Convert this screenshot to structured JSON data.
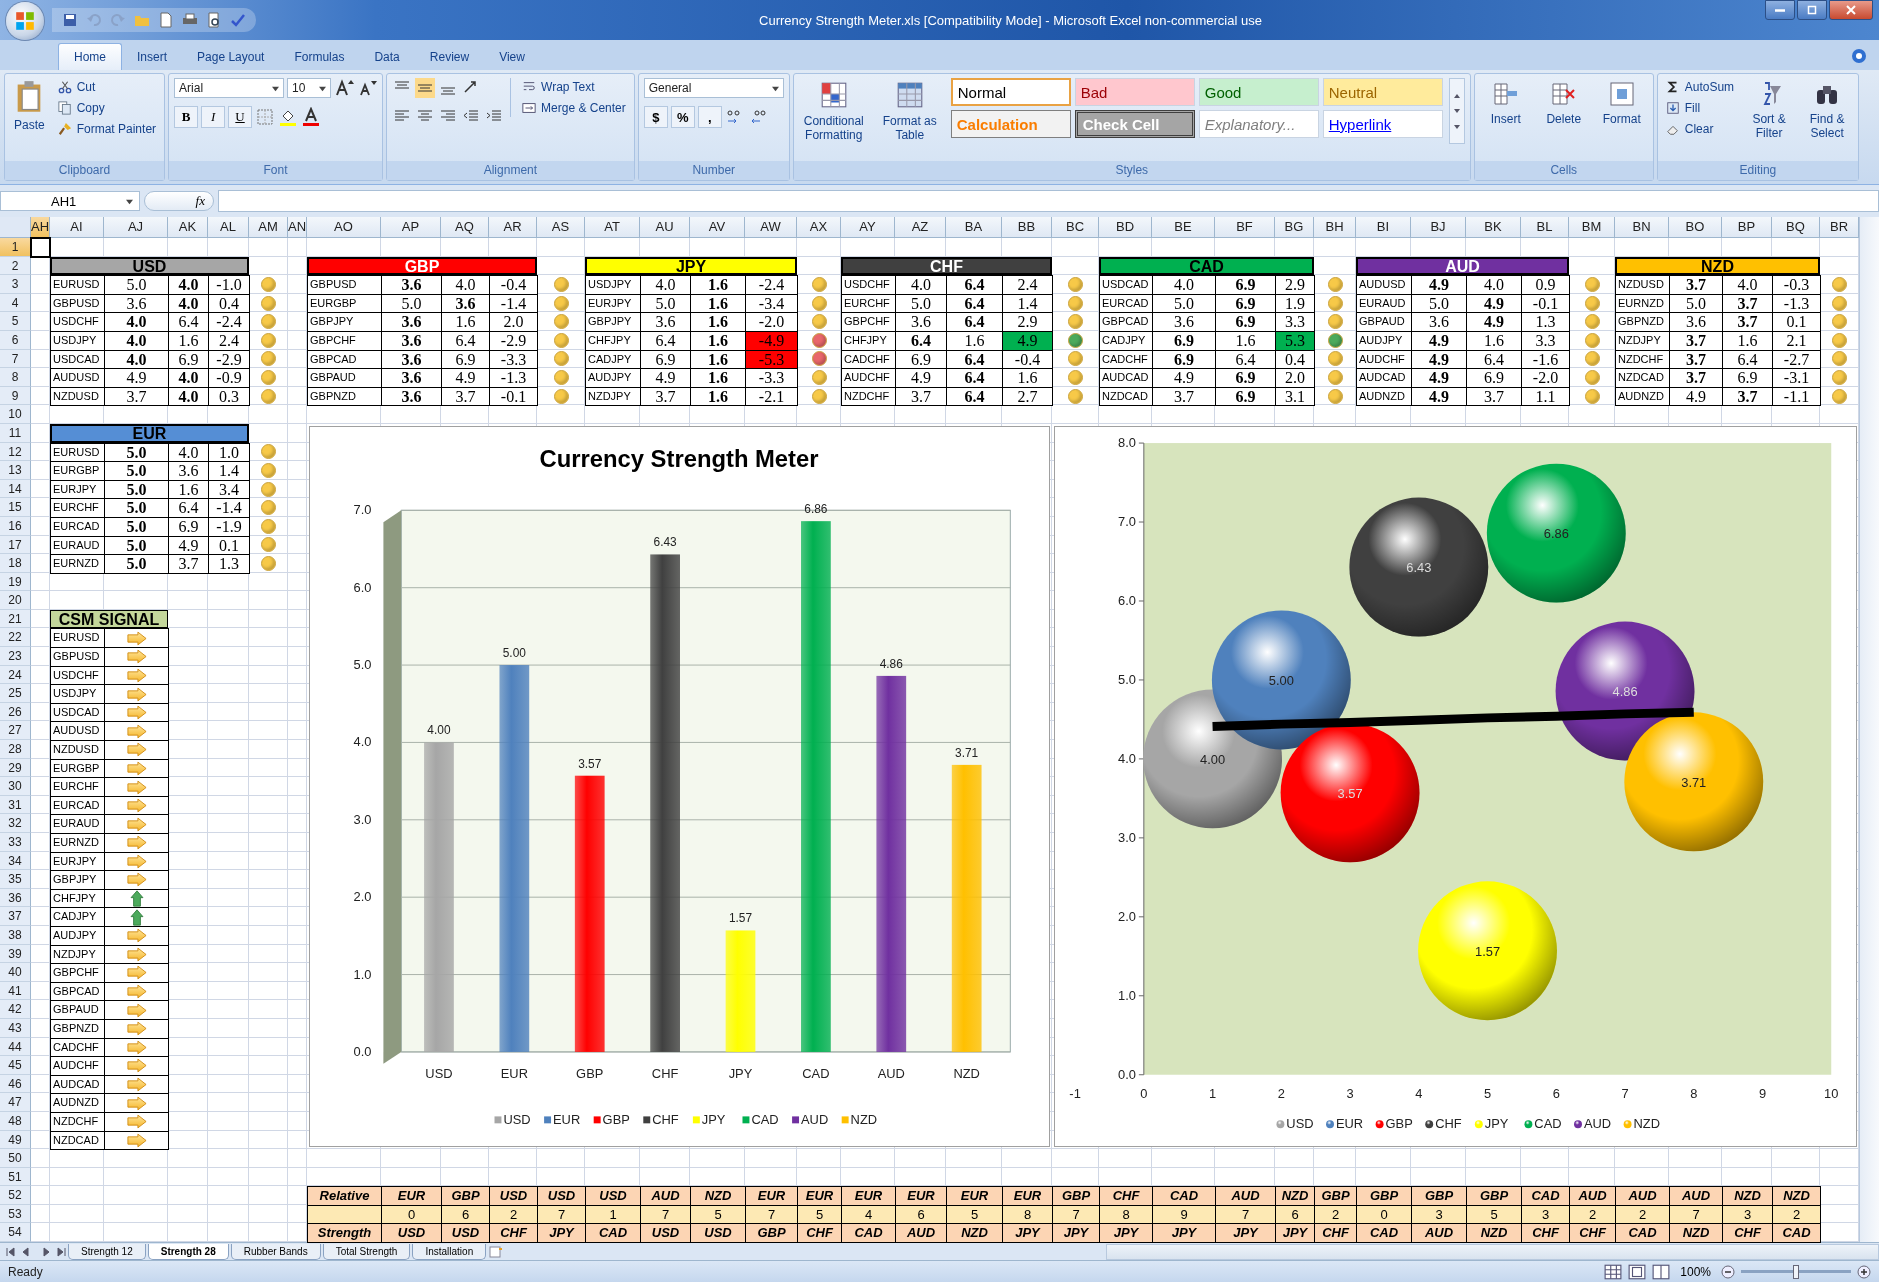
{
  "window": {
    "title": "Currency Strength Meter.xls  [Compatibility Mode] - Microsoft Excel non-commercial use"
  },
  "ribbon_tabs": [
    {
      "label": "Home",
      "selected": true
    },
    {
      "label": "Insert",
      "selected": false
    },
    {
      "label": "Page Layout",
      "selected": false
    },
    {
      "label": "Formulas",
      "selected": false
    },
    {
      "label": "Data",
      "selected": false
    },
    {
      "label": "Review",
      "selected": false
    },
    {
      "label": "View",
      "selected": false
    }
  ],
  "clipboard": {
    "label": "Clipboard",
    "paste": "Paste",
    "items": [
      "Cut",
      "Copy",
      "Format Painter"
    ]
  },
  "font": {
    "label": "Font",
    "family": "Arial",
    "size": "10",
    "styles": [
      "B",
      "I",
      "U"
    ]
  },
  "alignment": {
    "label": "Alignment",
    "items": [
      "Wrap Text",
      "Merge & Center"
    ]
  },
  "number": {
    "label": "Number",
    "format": "General",
    "symbols": [
      "$",
      "%",
      ","
    ]
  },
  "styles": {
    "label": "Styles",
    "buttons": [
      "Conditional Formatting",
      "Format as Table"
    ],
    "cell_styles": [
      {
        "label": "Normal",
        "kind": "normal"
      },
      {
        "label": "Bad",
        "kind": "bad"
      },
      {
        "label": "Good",
        "kind": "good"
      },
      {
        "label": "Neutral",
        "kind": "neutral"
      },
      {
        "label": "Calculation",
        "kind": "calculation"
      },
      {
        "label": "Check Cell",
        "kind": "check"
      },
      {
        "label": "Explanatory...",
        "kind": "explanatory"
      },
      {
        "label": "Hyperlink",
        "kind": "hyperlink"
      }
    ]
  },
  "cells": {
    "label": "Cells",
    "items": [
      "Insert",
      "Delete",
      "Format"
    ]
  },
  "editing": {
    "label": "Editing",
    "items": [
      "AutoSum",
      "Fill",
      "Clear"
    ],
    "big": [
      "Sort & Filter",
      "Find & Select"
    ]
  },
  "name_box": "AH1",
  "formula_label": "fx",
  "columns": [
    {
      "label": "AH",
      "selected": true
    },
    {
      "label": "AI",
      "selected": false
    },
    {
      "label": "AJ",
      "selected": false
    },
    {
      "label": "AK",
      "selected": false
    },
    {
      "label": "AL",
      "selected": false
    },
    {
      "label": "AM",
      "selected": false
    },
    {
      "label": "AN",
      "selected": false
    },
    {
      "label": "AO",
      "selected": false
    },
    {
      "label": "AP",
      "selected": false
    },
    {
      "label": "AQ",
      "selected": false
    },
    {
      "label": "AR",
      "selected": false
    },
    {
      "label": "AS",
      "selected": false
    },
    {
      "label": "AT",
      "selected": false
    },
    {
      "label": "AU",
      "selected": false
    },
    {
      "label": "AV",
      "selected": false
    },
    {
      "label": "AW",
      "selected": false
    },
    {
      "label": "AX",
      "selected": false
    },
    {
      "label": "AY",
      "selected": false
    },
    {
      "label": "AZ",
      "selected": false
    },
    {
      "label": "BA",
      "selected": false
    },
    {
      "label": "BB",
      "selected": false
    },
    {
      "label": "BC",
      "selected": false
    },
    {
      "label": "BD",
      "selected": false
    },
    {
      "label": "BE",
      "selected": false
    },
    {
      "label": "BF",
      "selected": false
    },
    {
      "label": "BG",
      "selected": false
    },
    {
      "label": "BH",
      "selected": false
    },
    {
      "label": "BI",
      "selected": false
    },
    {
      "label": "BJ",
      "selected": false
    },
    {
      "label": "BK",
      "selected": false
    },
    {
      "label": "BL",
      "selected": false
    },
    {
      "label": "BM",
      "selected": false
    },
    {
      "label": "BN",
      "selected": false
    },
    {
      "label": "BO",
      "selected": false
    },
    {
      "label": "BP",
      "selected": false
    },
    {
      "label": "BQ",
      "selected": false
    },
    {
      "label": "BR",
      "selected": false
    }
  ],
  "rows": [
    {
      "label": "1",
      "selected": true
    },
    {
      "label": "2",
      "selected": false
    },
    {
      "label": "3",
      "selected": false
    },
    {
      "label": "4",
      "selected": false
    },
    {
      "label": "5",
      "selected": false
    },
    {
      "label": "6",
      "selected": false
    },
    {
      "label": "7",
      "selected": false
    },
    {
      "label": "8",
      "selected": false
    },
    {
      "label": "9",
      "selected": false
    },
    {
      "label": "10",
      "selected": false
    },
    {
      "label": "11",
      "selected": false
    },
    {
      "label": "12",
      "selected": false
    },
    {
      "label": "13",
      "selected": false
    },
    {
      "label": "14",
      "selected": false
    },
    {
      "label": "15",
      "selected": false
    },
    {
      "label": "16",
      "selected": false
    },
    {
      "label": "17",
      "selected": false
    },
    {
      "label": "18",
      "selected": false
    },
    {
      "label": "19",
      "selected": false
    },
    {
      "label": "20",
      "selected": false
    },
    {
      "label": "21",
      "selected": false
    },
    {
      "label": "22",
      "selected": false
    },
    {
      "label": "23",
      "selected": false
    },
    {
      "label": "24",
      "selected": false
    },
    {
      "label": "25",
      "selected": false
    },
    {
      "label": "26",
      "selected": false
    },
    {
      "label": "27",
      "selected": false
    },
    {
      "label": "28",
      "selected": false
    },
    {
      "label": "29",
      "selected": false
    },
    {
      "label": "30",
      "selected": false
    },
    {
      "label": "31",
      "selected": false
    },
    {
      "label": "32",
      "selected": false
    },
    {
      "label": "33",
      "selected": false
    },
    {
      "label": "34",
      "selected": false
    },
    {
      "label": "35",
      "selected": false
    },
    {
      "label": "36",
      "selected": false
    },
    {
      "label": "37",
      "selected": false
    },
    {
      "label": "38",
      "selected": false
    },
    {
      "label": "39",
      "selected": false
    },
    {
      "label": "40",
      "selected": false
    },
    {
      "label": "41",
      "selected": false
    },
    {
      "label": "42",
      "selected": false
    },
    {
      "label": "43",
      "selected": false
    },
    {
      "label": "44",
      "selected": false
    },
    {
      "label": "45",
      "selected": false
    },
    {
      "label": "46",
      "selected": false
    },
    {
      "label": "47",
      "selected": false
    },
    {
      "label": "48",
      "selected": false
    },
    {
      "label": "49",
      "selected": false
    },
    {
      "label": "50",
      "selected": false
    },
    {
      "label": "51",
      "selected": false
    },
    {
      "label": "52",
      "selected": false
    },
    {
      "label": "53",
      "selected": false
    },
    {
      "label": "54",
      "selected": false
    }
  ],
  "tables": [
    {
      "currency": "USD",
      "color": "#a6a6a6",
      "rows": [
        {
          "pair": "EURUSD",
          "values": [
            "5.0",
            "4.0",
            "-1.0"
          ],
          "bold": [
            false,
            true
          ],
          "color": "#f7c948"
        },
        {
          "pair": "GBPUSD",
          "values": [
            "3.6",
            "4.0",
            "0.4"
          ],
          "bold": [
            false,
            true
          ],
          "color": "#f7c948"
        },
        {
          "pair": "USDCHF",
          "values": [
            "4.0",
            "6.4",
            "-2.4"
          ],
          "bold": [
            true,
            false
          ],
          "color": "#f7c948"
        },
        {
          "pair": "USDJPY",
          "values": [
            "4.0",
            "1.6",
            "2.4"
          ],
          "bold": [
            true,
            false
          ],
          "color": "#f7c948"
        },
        {
          "pair": "USDCAD",
          "values": [
            "4.0",
            "6.9",
            "-2.9"
          ],
          "bold": [
            true,
            false
          ],
          "color": "#f7c948"
        },
        {
          "pair": "AUDUSD",
          "values": [
            "4.9",
            "4.0",
            "-0.9"
          ],
          "bold": [
            false,
            true
          ],
          "color": "#f7c948"
        },
        {
          "pair": "NZDUSD",
          "values": [
            "3.7",
            "4.0",
            "0.3"
          ],
          "bold": [
            false,
            true
          ],
          "color": "#f7c948"
        }
      ]
    },
    {
      "currency": "GBP",
      "color": "#ff0000",
      "rows": [
        {
          "pair": "GBPUSD",
          "values": [
            "3.6",
            "4.0",
            "-0.4"
          ],
          "bold": [
            true,
            false
          ],
          "color": "#f7c948"
        },
        {
          "pair": "EURGBP",
          "values": [
            "5.0",
            "3.6",
            "-1.4"
          ],
          "bold": [
            false,
            true
          ],
          "color": "#f7c948"
        },
        {
          "pair": "GBPJPY",
          "values": [
            "3.6",
            "1.6",
            "2.0"
          ],
          "bold": [
            true,
            false
          ],
          "color": "#f7c948"
        },
        {
          "pair": "GBPCHF",
          "values": [
            "3.6",
            "6.4",
            "-2.9"
          ],
          "bold": [
            true,
            false
          ],
          "color": "#f7c948"
        },
        {
          "pair": "GBPCAD",
          "values": [
            "3.6",
            "6.9",
            "-3.3"
          ],
          "bold": [
            true,
            false
          ],
          "color": "#f7c948"
        },
        {
          "pair": "GBPAUD",
          "values": [
            "3.6",
            "4.9",
            "-1.3"
          ],
          "bold": [
            true,
            false
          ],
          "color": "#f7c948"
        },
        {
          "pair": "GBPNZD",
          "values": [
            "3.6",
            "3.7",
            "-0.1"
          ],
          "bold": [
            true,
            false
          ],
          "color": "#f7c948"
        }
      ]
    },
    {
      "currency": "JPY",
      "color": "#ffff00",
      "rows": [
        {
          "pair": "USDJPY",
          "values": [
            "4.0",
            "1.6",
            "-2.4"
          ],
          "bold": [
            false,
            true
          ],
          "color": "#f7c948"
        },
        {
          "pair": "EURJPY",
          "values": [
            "5.0",
            "1.6",
            "-3.4"
          ],
          "bold": [
            false,
            true
          ],
          "color": "#f7c948"
        },
        {
          "pair": "GBPJPY",
          "values": [
            "3.6",
            "1.6",
            "-2.0"
          ],
          "bold": [
            false,
            true
          ],
          "color": "#f7c948"
        },
        {
          "pair": "CHFJPY",
          "values": [
            "6.4",
            "1.6",
            "-4.9"
          ],
          "bold": [
            false,
            true
          ],
          "kind": "low",
          "color": "#e8676b"
        },
        {
          "pair": "CADJPY",
          "values": [
            "6.9",
            "1.6",
            "-5.3"
          ],
          "bold": [
            false,
            true
          ],
          "kind": "low",
          "color": "#e8676b"
        },
        {
          "pair": "AUDJPY",
          "values": [
            "4.9",
            "1.6",
            "-3.3"
          ],
          "bold": [
            false,
            true
          ],
          "color": "#f7c948"
        },
        {
          "pair": "NZDJPY",
          "values": [
            "3.7",
            "1.6",
            "-2.1"
          ],
          "bold": [
            false,
            true
          ],
          "color": "#f7c948"
        }
      ]
    },
    {
      "currency": "CHF",
      "color": "#404040",
      "rows": [
        {
          "pair": "USDCHF",
          "values": [
            "4.0",
            "6.4",
            "2.4"
          ],
          "bold": [
            false,
            true
          ],
          "color": "#f7c948"
        },
        {
          "pair": "EURCHF",
          "values": [
            "5.0",
            "6.4",
            "1.4"
          ],
          "bold": [
            false,
            true
          ],
          "color": "#f7c948"
        },
        {
          "pair": "GBPCHF",
          "values": [
            "3.6",
            "6.4",
            "2.9"
          ],
          "bold": [
            false,
            true
          ],
          "color": "#f7c948"
        },
        {
          "pair": "CHFJPY",
          "values": [
            "6.4",
            "1.6",
            "4.9"
          ],
          "bold": [
            true,
            false
          ],
          "kind": "high",
          "color": "#4caa5c"
        },
        {
          "pair": "CADCHF",
          "values": [
            "6.9",
            "6.4",
            "-0.4"
          ],
          "bold": [
            false,
            true
          ],
          "color": "#f7c948"
        },
        {
          "pair": "AUDCHF",
          "values": [
            "4.9",
            "6.4",
            "1.6"
          ],
          "bold": [
            false,
            true
          ],
          "color": "#f7c948"
        },
        {
          "pair": "NZDCHF",
          "values": [
            "3.7",
            "6.4",
            "2.7"
          ],
          "bold": [
            false,
            true
          ],
          "color": "#f7c948"
        }
      ]
    },
    {
      "currency": "CAD",
      "color": "#00b050",
      "rows": [
        {
          "pair": "USDCAD",
          "values": [
            "4.0",
            "6.9",
            "2.9"
          ],
          "bold": [
            false,
            true
          ],
          "color": "#f7c948"
        },
        {
          "pair": "EURCAD",
          "values": [
            "5.0",
            "6.9",
            "1.9"
          ],
          "bold": [
            false,
            true
          ],
          "color": "#f7c948"
        },
        {
          "pair": "GBPCAD",
          "values": [
            "3.6",
            "6.9",
            "3.3"
          ],
          "bold": [
            false,
            true
          ],
          "color": "#f7c948"
        },
        {
          "pair": "CADJPY",
          "values": [
            "6.9",
            "1.6",
            "5.3"
          ],
          "bold": [
            true,
            false
          ],
          "kind": "high",
          "color": "#4caa5c"
        },
        {
          "pair": "CADCHF",
          "values": [
            "6.9",
            "6.4",
            "0.4"
          ],
          "bold": [
            true,
            false
          ],
          "color": "#f7c948"
        },
        {
          "pair": "AUDCAD",
          "values": [
            "4.9",
            "6.9",
            "2.0"
          ],
          "bold": [
            false,
            true
          ],
          "color": "#f7c948"
        },
        {
          "pair": "NZDCAD",
          "values": [
            "3.7",
            "6.9",
            "3.1"
          ],
          "bold": [
            false,
            true
          ],
          "color": "#f7c948"
        }
      ]
    },
    {
      "currency": "AUD",
      "color": "#7030a0",
      "rows": [
        {
          "pair": "AUDUSD",
          "values": [
            "4.9",
            "4.0",
            "0.9"
          ],
          "bold": [
            true,
            false
          ],
          "color": "#f7c948"
        },
        {
          "pair": "EURAUD",
          "values": [
            "5.0",
            "4.9",
            "-0.1"
          ],
          "bold": [
            false,
            true
          ],
          "color": "#f7c948"
        },
        {
          "pair": "GBPAUD",
          "values": [
            "3.6",
            "4.9",
            "1.3"
          ],
          "bold": [
            false,
            true
          ],
          "color": "#f7c948"
        },
        {
          "pair": "AUDJPY",
          "values": [
            "4.9",
            "1.6",
            "3.3"
          ],
          "bold": [
            true,
            false
          ],
          "color": "#f7c948"
        },
        {
          "pair": "AUDCHF",
          "values": [
            "4.9",
            "6.4",
            "-1.6"
          ],
          "bold": [
            true,
            false
          ],
          "color": "#f7c948"
        },
        {
          "pair": "AUDCAD",
          "values": [
            "4.9",
            "6.9",
            "-2.0"
          ],
          "bold": [
            true,
            false
          ],
          "color": "#f7c948"
        },
        {
          "pair": "AUDNZD",
          "values": [
            "4.9",
            "3.7",
            "1.1"
          ],
          "bold": [
            true,
            false
          ],
          "color": "#f7c948"
        }
      ]
    },
    {
      "currency": "NZD",
      "color": "#ffc000",
      "rows": [
        {
          "pair": "NZDUSD",
          "values": [
            "3.7",
            "4.0",
            "-0.3"
          ],
          "bold": [
            true,
            false
          ],
          "color": "#f7c948"
        },
        {
          "pair": "EURNZD",
          "values": [
            "5.0",
            "3.7",
            "-1.3"
          ],
          "bold": [
            false,
            true
          ],
          "color": "#f7c948"
        },
        {
          "pair": "GBPNZD",
          "values": [
            "3.6",
            "3.7",
            "0.1"
          ],
          "bold": [
            false,
            true
          ],
          "color": "#f7c948"
        },
        {
          "pair": "NZDJPY",
          "values": [
            "3.7",
            "1.6",
            "2.1"
          ],
          "bold": [
            true,
            false
          ],
          "color": "#f7c948"
        },
        {
          "pair": "NZDCHF",
          "values": [
            "3.7",
            "6.4",
            "-2.7"
          ],
          "bold": [
            true,
            false
          ],
          "color": "#f7c948"
        },
        {
          "pair": "NZDCAD",
          "values": [
            "3.7",
            "6.9",
            "-3.1"
          ],
          "bold": [
            true,
            false
          ],
          "color": "#f7c948"
        },
        {
          "pair": "AUDNZD",
          "values": [
            "4.9",
            "3.7",
            "-1.1"
          ],
          "bold": [
            false,
            true
          ],
          "color": "#f7c948"
        }
      ]
    },
    {
      "currency": "EUR",
      "color": "#558ed5",
      "rows": [
        {
          "pair": "EURUSD",
          "values": [
            "5.0",
            "4.0",
            "1.0"
          ],
          "bold": [
            true,
            false
          ],
          "color": "#f7c948"
        },
        {
          "pair": "EURGBP",
          "values": [
            "5.0",
            "3.6",
            "1.4"
          ],
          "bold": [
            true,
            false
          ],
          "color": "#f7c948"
        },
        {
          "pair": "EURJPY",
          "values": [
            "5.0",
            "1.6",
            "3.4"
          ],
          "bold": [
            true,
            false
          ],
          "color": "#f7c948"
        },
        {
          "pair": "EURCHF",
          "values": [
            "5.0",
            "6.4",
            "-1.4"
          ],
          "bold": [
            true,
            false
          ],
          "color": "#f7c948"
        },
        {
          "pair": "EURCAD",
          "values": [
            "5.0",
            "6.9",
            "-1.9"
          ],
          "bold": [
            true,
            false
          ],
          "color": "#f7c948"
        },
        {
          "pair": "EURAUD",
          "values": [
            "5.0",
            "4.9",
            "0.1"
          ],
          "bold": [
            true,
            false
          ],
          "color": "#f7c948"
        },
        {
          "pair": "EURNZD",
          "values": [
            "5.0",
            "3.7",
            "1.3"
          ],
          "bold": [
            true,
            false
          ],
          "color": "#f7c948"
        }
      ]
    }
  ],
  "signal": {
    "title": "CSM SIGNAL",
    "rows": [
      {
        "pair": "EURUSD",
        "kind": "right"
      },
      {
        "pair": "GBPUSD",
        "kind": "right"
      },
      {
        "pair": "USDCHF",
        "kind": "right"
      },
      {
        "pair": "USDJPY",
        "kind": "right"
      },
      {
        "pair": "USDCAD",
        "kind": "right"
      },
      {
        "pair": "AUDUSD",
        "kind": "right"
      },
      {
        "pair": "NZDUSD",
        "kind": "right"
      },
      {
        "pair": "EURGBP",
        "kind": "right"
      },
      {
        "pair": "EURCHF",
        "kind": "right"
      },
      {
        "pair": "EURCAD",
        "kind": "right"
      },
      {
        "pair": "EURAUD",
        "kind": "right"
      },
      {
        "pair": "EURNZD",
        "kind": "right"
      },
      {
        "pair": "EURJPY",
        "kind": "right"
      },
      {
        "pair": "GBPJPY",
        "kind": "right"
      },
      {
        "pair": "CHFJPY",
        "kind": "up"
      },
      {
        "pair": "CADJPY",
        "kind": "up"
      },
      {
        "pair": "AUDJPY",
        "kind": "right"
      },
      {
        "pair": "NZDJPY",
        "kind": "right"
      },
      {
        "pair": "GBPCHF",
        "kind": "right"
      },
      {
        "pair": "GBPCAD",
        "kind": "right"
      },
      {
        "pair": "GBPAUD",
        "kind": "right"
      },
      {
        "pair": "GBPNZD",
        "kind": "right"
      },
      {
        "pair": "CADCHF",
        "kind": "right"
      },
      {
        "pair": "AUDCHF",
        "kind": "right"
      },
      {
        "pair": "AUDCAD",
        "kind": "right"
      },
      {
        "pair": "AUDNZD",
        "kind": "right"
      },
      {
        "pair": "NZDCHF",
        "kind": "right"
      },
      {
        "pair": "NZDCAD",
        "kind": "right"
      }
    ]
  },
  "bar_chart": {
    "chart_data": {
      "type": "bar",
      "title": "Currency Strength Meter",
      "categories": [
        "USD",
        "EUR",
        "GBP",
        "CHF",
        "JPY",
        "CAD",
        "AUD",
        "NZD"
      ],
      "ylim": [
        0,
        7
      ],
      "yticks": [
        {
          "value": 0,
          "label": "0.0"
        },
        {
          "value": 1,
          "label": "1.0"
        },
        {
          "value": 2,
          "label": "2.0"
        },
        {
          "value": 3,
          "label": "3.0"
        },
        {
          "value": 4,
          "label": "4.0"
        },
        {
          "value": 5,
          "label": "5.0"
        },
        {
          "value": 6,
          "label": "6.0"
        },
        {
          "value": 7,
          "label": "7.0"
        }
      ],
      "grid": true,
      "legend": true,
      "series": [
        {
          "name": "USD",
          "color": "#a6a6a6",
          "values": [
            4.0,
            null,
            null,
            null,
            null,
            null,
            null,
            null
          ],
          "value_labels": [
            "4.00",
            null,
            null,
            null,
            null,
            null,
            null,
            null
          ]
        },
        {
          "name": "EUR",
          "color": "#4f81bd",
          "values": [
            null,
            5.0,
            null,
            null,
            null,
            null,
            null,
            null
          ],
          "value_labels": [
            null,
            "5.00",
            null,
            null,
            null,
            null,
            null,
            null
          ]
        },
        {
          "name": "GBP",
          "color": "#ff0000",
          "values": [
            null,
            null,
            3.57,
            null,
            null,
            null,
            null,
            null
          ],
          "value_labels": [
            null,
            null,
            "3.57",
            null,
            null,
            null,
            null,
            null
          ]
        },
        {
          "name": "CHF",
          "color": "#404040",
          "values": [
            null,
            null,
            null,
            6.43,
            null,
            null,
            null,
            null
          ],
          "value_labels": [
            null,
            null,
            null,
            "6.43",
            null,
            null,
            null,
            null
          ]
        },
        {
          "name": "JPY",
          "color": "#ffff00",
          "values": [
            null,
            null,
            null,
            null,
            1.57,
            null,
            null,
            null
          ],
          "value_labels": [
            null,
            null,
            null,
            null,
            "1.57",
            null,
            null,
            null
          ]
        },
        {
          "name": "CAD",
          "color": "#00b050",
          "values": [
            null,
            null,
            null,
            null,
            null,
            6.86,
            null,
            null
          ],
          "value_labels": [
            null,
            null,
            null,
            null,
            null,
            "6.86",
            null,
            null
          ]
        },
        {
          "name": "AUD",
          "color": "#7030a0",
          "values": [
            null,
            null,
            null,
            null,
            null,
            null,
            4.86,
            null
          ],
          "value_labels": [
            null,
            null,
            null,
            null,
            null,
            null,
            "4.86",
            null
          ]
        },
        {
          "name": "NZD",
          "color": "#ffc000",
          "values": [
            null,
            null,
            null,
            null,
            null,
            null,
            null,
            3.71
          ],
          "value_labels": [
            null,
            null,
            null,
            null,
            null,
            null,
            null,
            "3.71"
          ]
        }
      ]
    }
  },
  "bubble_chart": {
    "chart_data": {
      "type": "scatter",
      "x": [
        1,
        2,
        3,
        4,
        5,
        6,
        7,
        8
      ],
      "xlim": [
        -1,
        10
      ],
      "ylim": [
        0,
        8
      ],
      "xticks": [
        -1,
        0,
        1,
        2,
        3,
        4,
        5,
        6,
        7,
        8,
        9,
        10
      ],
      "yticks": [
        {
          "value": 0,
          "label": "0.0"
        },
        {
          "value": 1,
          "label": "1.0"
        },
        {
          "value": 2,
          "label": "2.0"
        },
        {
          "value": 3,
          "label": "3.0"
        },
        {
          "value": 4,
          "label": "4.0"
        },
        {
          "value": 5,
          "label": "5.0"
        },
        {
          "value": 6,
          "label": "6.0"
        },
        {
          "value": 7,
          "label": "7.0"
        },
        {
          "value": 8,
          "label": "8.0"
        }
      ],
      "legend": true,
      "series": [
        {
          "name": "USD",
          "color": "#a6a6a6",
          "values": [
            4.0,
            null,
            null,
            null,
            null,
            null,
            null,
            null
          ],
          "value_labels": [
            "4.00",
            null,
            null,
            null,
            null,
            null,
            null,
            null
          ]
        },
        {
          "name": "EUR",
          "color": "#4f81bd",
          "values": [
            null,
            5.0,
            null,
            null,
            null,
            null,
            null,
            null
          ],
          "value_labels": [
            null,
            "5.00",
            null,
            null,
            null,
            null,
            null,
            null
          ]
        },
        {
          "name": "GBP",
          "color": "#ff0000",
          "values": [
            null,
            null,
            3.57,
            null,
            null,
            null,
            null,
            null
          ],
          "value_labels": [
            null,
            null,
            "3.57",
            null,
            null,
            null,
            null,
            null
          ]
        },
        {
          "name": "CHF",
          "color": "#404040",
          "values": [
            null,
            null,
            null,
            6.43,
            null,
            null,
            null,
            null
          ],
          "value_labels": [
            null,
            null,
            null,
            "6.43",
            null,
            null,
            null,
            null
          ]
        },
        {
          "name": "JPY",
          "color": "#ffff00",
          "values": [
            null,
            null,
            null,
            null,
            1.57,
            null,
            null,
            null
          ],
          "value_labels": [
            null,
            null,
            null,
            null,
            "1.57",
            null,
            null,
            null
          ]
        },
        {
          "name": "CAD",
          "color": "#00b050",
          "values": [
            null,
            null,
            null,
            null,
            null,
            6.86,
            null,
            null
          ],
          "value_labels": [
            null,
            null,
            null,
            null,
            null,
            "6.86",
            null,
            null
          ]
        },
        {
          "name": "AUD",
          "color": "#7030a0",
          "values": [
            null,
            null,
            null,
            null,
            null,
            null,
            4.86,
            null
          ],
          "value_labels": [
            null,
            null,
            null,
            null,
            null,
            null,
            "4.86",
            null
          ]
        },
        {
          "name": "NZD",
          "color": "#ffc000",
          "values": [
            null,
            null,
            null,
            null,
            null,
            null,
            null,
            3.71
          ],
          "value_labels": [
            null,
            null,
            null,
            null,
            null,
            null,
            null,
            "3.71"
          ]
        },
        {
          "type": "line",
          "color": "#000000",
          "values": [
            4.41,
            4.44,
            4.46,
            4.49,
            4.52,
            4.54,
            4.57,
            4.59
          ]
        }
      ]
    }
  },
  "strength_table": {
    "row_labels": [
      "Relative",
      "Strength"
    ],
    "relative": [
      "EUR",
      "GBP",
      "USD",
      "USD",
      "USD",
      "AUD",
      "NZD",
      "EUR",
      "EUR",
      "EUR",
      "EUR",
      "EUR",
      "EUR",
      "GBP",
      "CHF",
      "CAD",
      "AUD",
      "NZD",
      "GBP",
      "GBP",
      "GBP",
      "GBP",
      "CAD",
      "AUD",
      "AUD",
      "AUD",
      "NZD",
      "NZD"
    ],
    "counts": [
      "0",
      "6",
      "2",
      "7",
      "1",
      "7",
      "5",
      "7",
      "5",
      "4",
      "6",
      "5",
      "8",
      "7",
      "8",
      "9",
      "7",
      "6",
      "2",
      "0",
      "3",
      "5",
      "3",
      "2",
      "2",
      "7",
      "3",
      "2"
    ],
    "strength": [
      "USD",
      "USD",
      "CHF",
      "JPY",
      "CAD",
      "USD",
      "USD",
      "GBP",
      "CHF",
      "CAD",
      "AUD",
      "NZD",
      "JPY",
      "JPY",
      "JPY",
      "JPY",
      "JPY",
      "JPY",
      "CHF",
      "CAD",
      "AUD",
      "NZD",
      "CHF",
      "CHF",
      "CAD",
      "NZD",
      "CHF",
      "CAD"
    ]
  },
  "sheet_tabs": [
    {
      "label": "Strength 12",
      "selected": false
    },
    {
      "label": "Strength 28",
      "selected": true
    },
    {
      "label": "Rubber Bands",
      "selected": false
    },
    {
      "label": "Total Strength",
      "selected": false
    },
    {
      "label": "Installation",
      "selected": false
    }
  ],
  "status_bar": {
    "text": "Ready",
    "zoom": "100%",
    "zoom_slider": {
      "level": 0.5
    }
  }
}
